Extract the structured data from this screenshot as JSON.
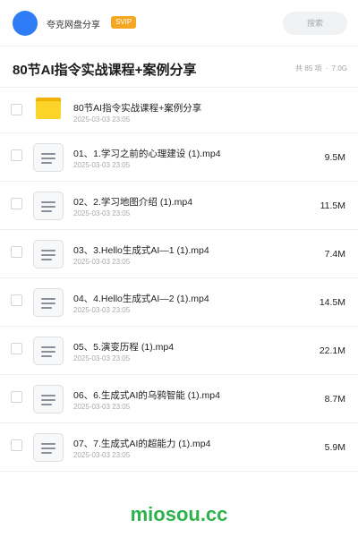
{
  "header": {
    "owner_name": "夸克网盘分享",
    "badge": "SVIP",
    "search_placeholder": "搜索",
    "accent_color": "#2f7cf6"
  },
  "share": {
    "title": "80节AI指令实战课程+案例分享",
    "count_label": "共 85 项",
    "separator": "·",
    "total_size": "7.0G"
  },
  "items": [
    {
      "type": "folder",
      "name": "80节AI指令实战课程+案例分享",
      "date": "2025-03-03 23:05",
      "size": ""
    },
    {
      "type": "file",
      "name": "01、1.学习之前的心理建设 (1).mp4",
      "date": "2025-03-03 23:05",
      "size": "9.5M"
    },
    {
      "type": "file",
      "name": "02、2.学习地图介绍 (1).mp4",
      "date": "2025-03-03 23:05",
      "size": "11.5M"
    },
    {
      "type": "file",
      "name": "03、3.Hello生成式AI—1 (1).mp4",
      "date": "2025-03-03 23:05",
      "size": "7.4M"
    },
    {
      "type": "file",
      "name": "04、4.Hello生成式AI—2 (1).mp4",
      "date": "2025-03-03 23:05",
      "size": "14.5M"
    },
    {
      "type": "file",
      "name": "05、5.演变历程 (1).mp4",
      "date": "2025-03-03 23:05",
      "size": "22.1M"
    },
    {
      "type": "file",
      "name": "06、6.生成式AI的乌鸦智能 (1).mp4",
      "date": "2025-03-03 23:05",
      "size": "8.7M"
    },
    {
      "type": "file",
      "name": "07、7.生成式AI的超能力 (1).mp4",
      "date": "2025-03-03 23:05",
      "size": "5.9M"
    }
  ],
  "watermark": "miosou.cc"
}
